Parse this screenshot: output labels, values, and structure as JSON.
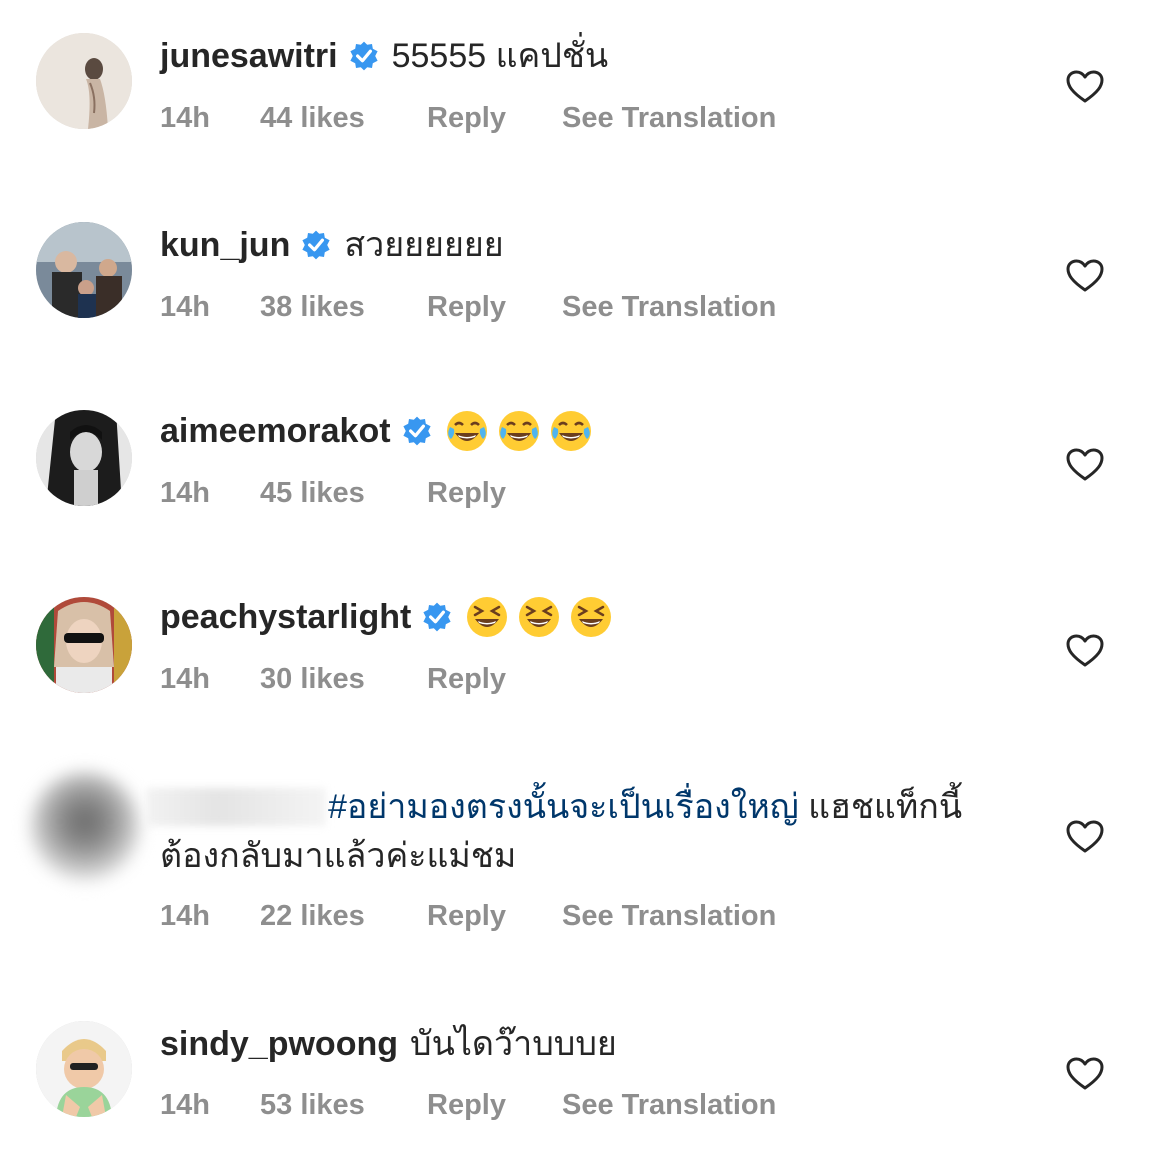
{
  "icons": {
    "verified": "verified-badge-icon",
    "like": "heart-outline-icon",
    "emoji_laugh_tears": "face-with-tears-of-joy",
    "emoji_squint_grin": "grinning-squinting-face"
  },
  "colors": {
    "verified": "#3897f0",
    "meta": "#8e8e8e",
    "hashtag": "#00376b",
    "text": "#262626"
  },
  "comments": [
    {
      "username": "junesawitri",
      "text": "55555 แคปชั่น",
      "time": "14h",
      "likes": "44 likes",
      "reply": "Reply",
      "translation": "See Translation"
    },
    {
      "username": "kun_jun",
      "text": "สวยยยยยย",
      "time": "14h",
      "likes": "38 likes",
      "reply": "Reply",
      "translation": "See Translation"
    },
    {
      "username": "aimeemorakot",
      "text": "😂😂😂",
      "time": "14h",
      "likes": "45 likes",
      "reply": "Reply"
    },
    {
      "username": "peachystarlight",
      "text": "😆😆😆",
      "time": "14h",
      "likes": "30 likes",
      "reply": "Reply"
    },
    {
      "username": "",
      "hashtag": "#อย่ามองตรงนั้นจะเป็นเรื่องใหญ่",
      "text": " แฮชแท็กนี้",
      "text_line2": "ต้องกลับมาแล้วค่ะแม่ชม",
      "time": "14h",
      "likes": "22 likes",
      "reply": "Reply",
      "translation": "See Translation"
    },
    {
      "username": "sindy_pwoong",
      "text": "บันไดว๊าบบบย",
      "time": "14h",
      "likes": "53 likes",
      "reply": "Reply",
      "translation": "See Translation"
    }
  ]
}
